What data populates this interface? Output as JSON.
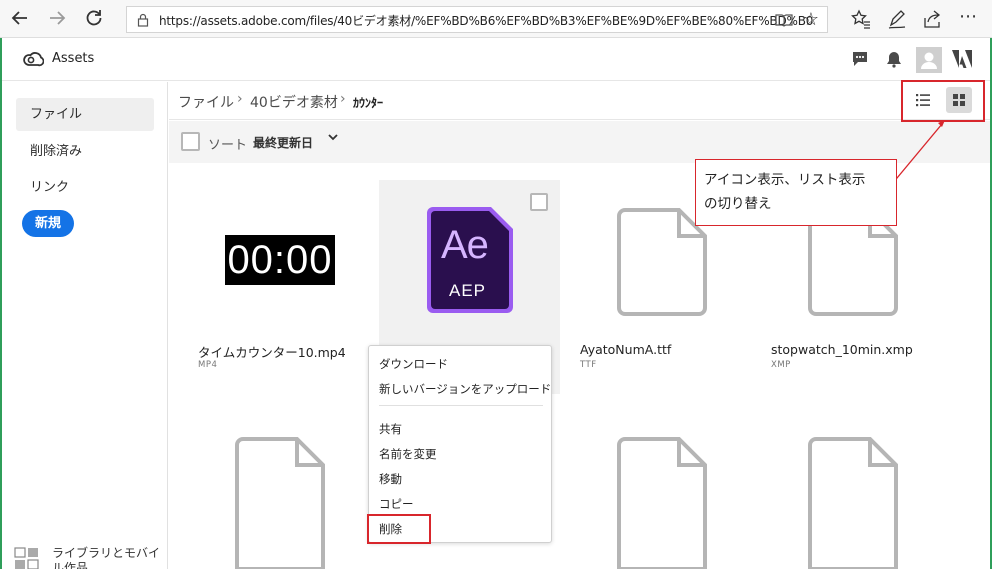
{
  "browser": {
    "url": "https://assets.adobe.com/files/40ビデオ素材/%EF%BD%B6%EF%BD%B3%EF%BE%9D%EF%BE%80%EF%BD%B0",
    "icons": [
      "back-icon",
      "forward-icon",
      "refresh-icon",
      "lock-icon",
      "reading-view-icon",
      "favorite-star-icon",
      "favorites-icon",
      "pen-icon",
      "share-icon",
      "more-icon"
    ]
  },
  "app": {
    "title": "Assets",
    "icons": [
      "creative-cloud-logo",
      "chat-icon",
      "bell-icon",
      "avatar",
      "adobe-logo"
    ]
  },
  "sidebar": {
    "items": [
      {
        "label": "ファイル",
        "active": true
      },
      {
        "label": "削除済み",
        "active": false
      },
      {
        "label": "リンク",
        "active": false
      }
    ],
    "new_button": "新規",
    "bottom_label": "ライブラリとモバイル作品"
  },
  "breadcrumb": {
    "items": [
      "ファイル",
      "40ビデオ素材",
      "ｶｳﾝﾀｰ"
    ]
  },
  "view": {
    "current": "grid"
  },
  "sort": {
    "label": "ソート",
    "value": "最終更新日"
  },
  "files": [
    {
      "name": "タイムカウンター10.mp4",
      "type": "MP4",
      "thumb": "00:00"
    },
    {
      "name": "",
      "type": "",
      "thumb": "Ae",
      "badge": "AEP"
    },
    {
      "name": "AyatoNumA.ttf",
      "type": "TTF"
    },
    {
      "name": "stopwatch_10min.xmp",
      "type": "XMP"
    }
  ],
  "context_menu": {
    "items_group1": [
      "ダウンロード",
      "新しいバージョンをアップロード"
    ],
    "items_group2": [
      "共有",
      "名前を変更",
      "移動",
      "コピー",
      "削除"
    ]
  },
  "annotation": {
    "text_line1": "アイコン表示、リスト表示",
    "text_line2": "の切り替え"
  },
  "colors": {
    "accent": "#1473e6",
    "highlight": "#d8262c",
    "ae_bg": "#2a0f4e",
    "ae_border": "#9a5cf0",
    "ae_text": "#d5b5ff"
  }
}
